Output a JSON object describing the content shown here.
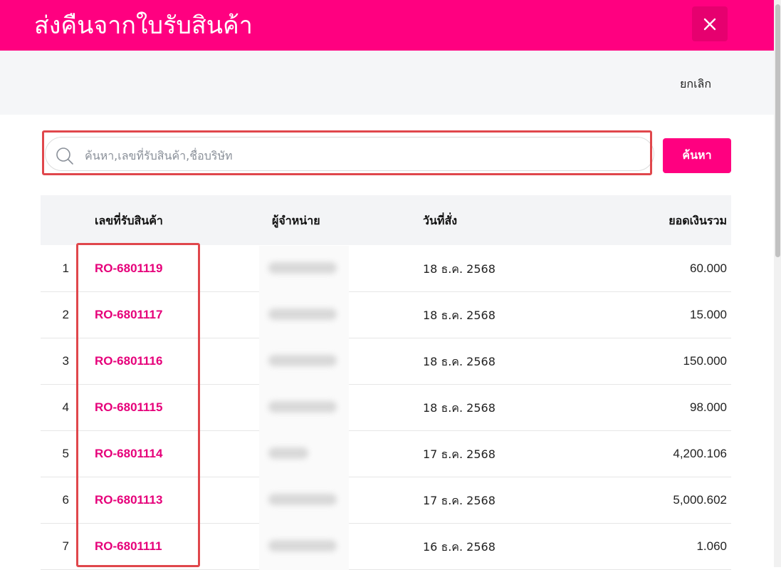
{
  "modal": {
    "title": "ส่งคืนจากใบรับสินค้า",
    "close_icon": "close-icon",
    "cancel_label": "ยกเลิก"
  },
  "search": {
    "placeholder": "ค้นหา,เลขที่รับสินค้า,ชื่อบริษัท",
    "value": "",
    "button_label": "ค้นหา",
    "icon": "search-icon"
  },
  "table": {
    "headers": {
      "receipt_no": "เลขที่รับสินค้า",
      "supplier": "ผู้จำหน่าย",
      "order_date": "วันที่สั่ง",
      "total": "ยอดเงินรวม"
    },
    "rows": [
      {
        "no": "1",
        "receipt_no": "RO-6801119",
        "date": "18 ธ.ค. 2568",
        "total": "60.000"
      },
      {
        "no": "2",
        "receipt_no": "RO-6801117",
        "date": "18 ธ.ค. 2568",
        "total": "15.000"
      },
      {
        "no": "3",
        "receipt_no": "RO-6801116",
        "date": "18 ธ.ค. 2568",
        "total": "150.000"
      },
      {
        "no": "4",
        "receipt_no": "RO-6801115",
        "date": "18 ธ.ค. 2568",
        "total": "98.000"
      },
      {
        "no": "5",
        "receipt_no": "RO-6801114",
        "date": "17 ธ.ค. 2568",
        "total": "4,200.106"
      },
      {
        "no": "6",
        "receipt_no": "RO-6801113",
        "date": "17 ธ.ค. 2568",
        "total": "5,000.602"
      },
      {
        "no": "7",
        "receipt_no": "RO-6801111",
        "date": "16 ธ.ค. 2568",
        "total": "1.060"
      }
    ]
  },
  "colors": {
    "brand": "#ff0080",
    "link": "#e6007a",
    "highlight": "#e0474c"
  }
}
